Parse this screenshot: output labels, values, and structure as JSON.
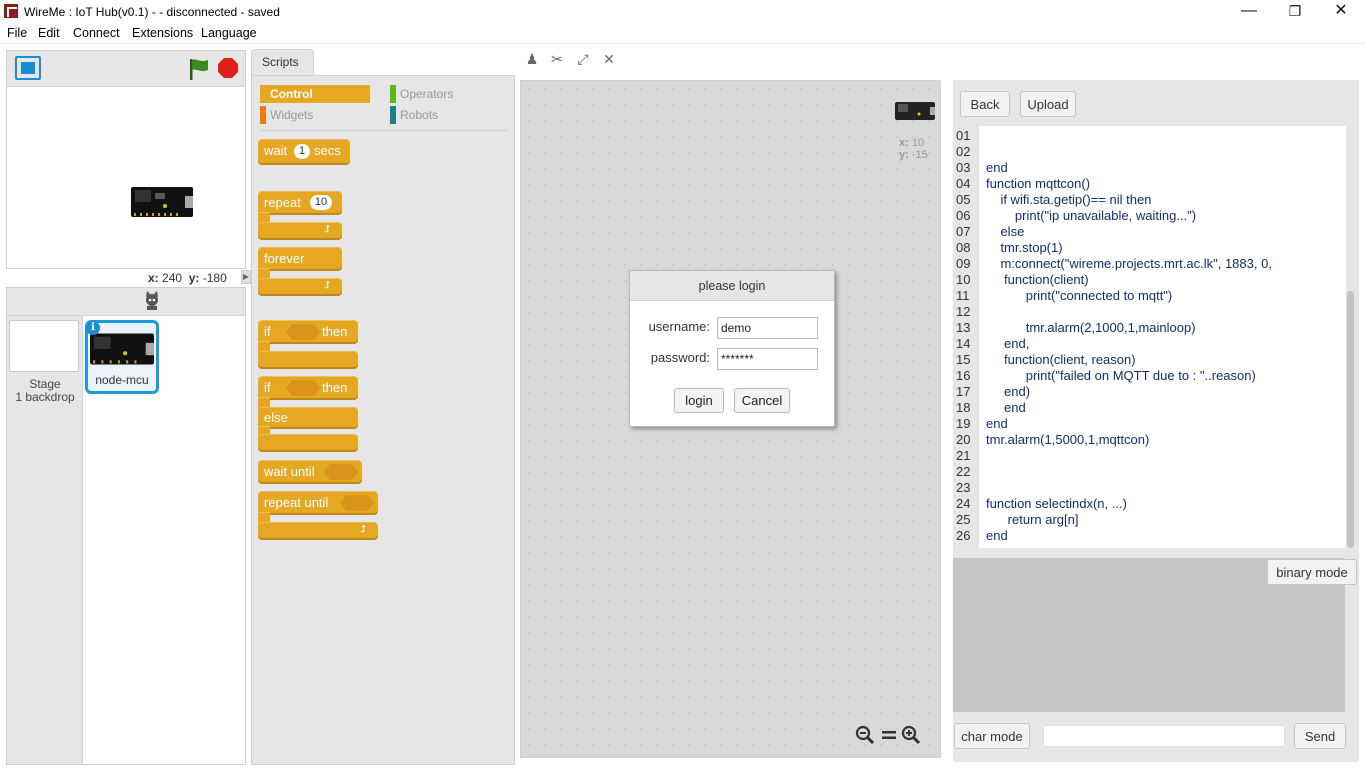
{
  "window": {
    "title": "WireMe : IoT Hub(v0.1) -  - disconnected - saved",
    "minimize_glyph": "—",
    "maximize_glyph": "❐",
    "close_glyph": "✕"
  },
  "menu": [
    "File",
    "Edit",
    "Connect",
    "Extensions",
    "Language"
  ],
  "stage": {
    "x_label": "x:",
    "x_value": "240",
    "y_label": "y:",
    "y_value": "-180"
  },
  "sprites": {
    "stage_label": "Stage",
    "backdrop_label": "1 backdrop",
    "sprite_name": "node-mcu",
    "info_glyph": "i"
  },
  "scripts_tab": "Scripts",
  "categories": {
    "control": "Control",
    "operators": "Operators",
    "widgets": "Widgets",
    "robots": "Robots",
    "colors": {
      "control": "#e6a823",
      "operators": "#5cb712",
      "widgets": "#f07a10",
      "robots": "#1a7f8e"
    }
  },
  "blocks": {
    "wait": "wait",
    "wait_value": "1",
    "wait_unit": "secs",
    "repeat": "repeat",
    "repeat_value": "10",
    "forever": "forever",
    "if": "if",
    "then": "then",
    "if2": "if",
    "then2": "then",
    "else": "else",
    "wait_until": "wait until",
    "repeat_until": "repeat until",
    "loop_glyph": "⮥"
  },
  "script_area": {
    "x_label": "x:",
    "x_value": "10",
    "y_label": "y:",
    "y_value": "-15"
  },
  "login": {
    "title": "please login",
    "username_label": "username:",
    "username_value": "demo",
    "password_label": "password:",
    "password_value": "*******",
    "login_button": "login",
    "cancel_button": "Cancel"
  },
  "code": {
    "back_button": "Back",
    "upload_button": "Upload",
    "binary_mode_button": "binary mode",
    "char_mode_button": "char mode",
    "send_button": "Send",
    "line_numbers": [
      "01",
      "02",
      "03",
      "04",
      "05",
      "06",
      "07",
      "08",
      "09",
      "10",
      "11",
      "12",
      "13",
      "14",
      "15",
      "16",
      "17",
      "18",
      "19",
      "20",
      "21",
      "22",
      "23",
      "24",
      "25",
      "26"
    ],
    "lines": [
      "",
      "",
      "end",
      "function mqttcon()",
      "    if wifi.sta.getip()== nil then",
      "        print(\"ip unavailable, waiting...\")",
      "    else",
      "    tmr.stop(1)",
      "    m:connect(\"wireme.projects.mrt.ac.lk\", 1883, 0,",
      "     function(client)",
      "           print(\"connected to mqtt\")",
      "",
      "           tmr.alarm(2,1000,1,mainloop)",
      "     end,",
      "     function(client, reason)",
      "           print(\"failed on MQTT due to : \"..reason)",
      "     end)",
      "     end",
      "end",
      "tmr.alarm(1,5000,1,mqttcon)",
      "",
      "",
      "",
      "function selectindx(n, ...)",
      "      return arg[n]",
      "end"
    ]
  }
}
